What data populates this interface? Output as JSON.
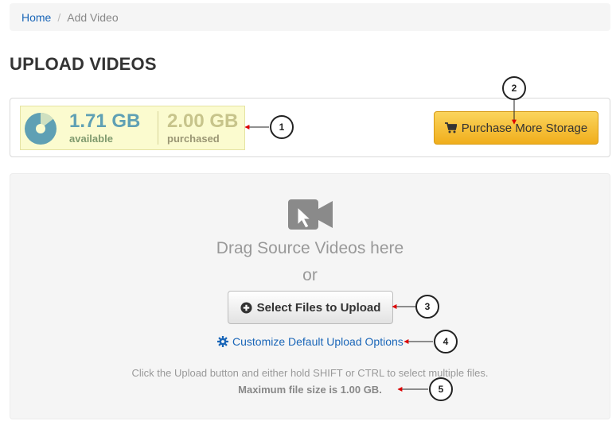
{
  "breadcrumb": {
    "home": "Home",
    "separator": "/",
    "current": "Add Video"
  },
  "page_title": "UPLOAD VIDEOS",
  "storage": {
    "used_fraction": 0.145,
    "available_amount": "1.71 GB",
    "available_label": "available",
    "purchased_amount": "2.00 GB",
    "purchased_label": "purchased",
    "purchase_button": "Purchase More Storage"
  },
  "upload": {
    "drag_text": "Drag Source Videos here",
    "or_text": "or",
    "select_button": "Select Files to Upload",
    "customize_link": "Customize Default Upload Options",
    "help_text": "Click the Upload button and either hold SHIFT or CTRL to select multiple files.",
    "max_size_text": "Maximum file size is 1.00 GB."
  },
  "callouts": [
    "1",
    "2",
    "3",
    "4",
    "5"
  ],
  "icons": {
    "storage": "pie-chart-icon",
    "cart": "cart-icon",
    "upload": "video-camera-icon",
    "plus": "plus-circle-icon",
    "gear": "gear-icon"
  },
  "colors": {
    "link": "#1a66b8",
    "purchase_button": "#f5bd2e",
    "storage_box": "#fbfbcf",
    "available": "#5fa0b4",
    "callout_arrow": "#dd0000"
  }
}
